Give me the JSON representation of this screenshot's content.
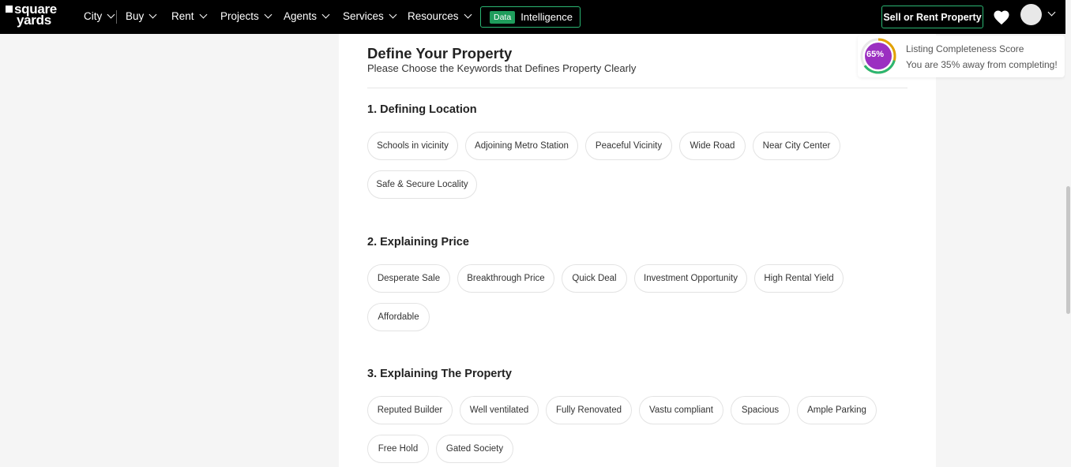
{
  "header": {
    "logo_line1": "square",
    "logo_line2": "yards",
    "nav": [
      {
        "label": "City"
      },
      {
        "label": "Buy"
      },
      {
        "label": "Rent"
      },
      {
        "label": "Projects"
      },
      {
        "label": "Agents"
      },
      {
        "label": "Services"
      },
      {
        "label": "Resources"
      }
    ],
    "data_badge": "Data",
    "data_label": "Intelligence",
    "sell_label": "Sell or Rent Property"
  },
  "form": {
    "title": "Define Your Property",
    "subtitle": "Please Choose the Keywords that Defines Property Clearly",
    "sections": [
      {
        "title": "1. Defining Location",
        "chips": [
          "Schools in vicinity",
          "Adjoining Metro Station",
          "Peaceful Vicinity",
          "Wide Road",
          "Near City Center",
          "Safe & Secure Locality"
        ]
      },
      {
        "title": "2. Explaining Price",
        "chips": [
          "Desperate Sale",
          "Breakthrough Price",
          "Quick Deal",
          "Investment Opportunity",
          "High Rental Yield",
          "Affordable"
        ]
      },
      {
        "title": "3. Explaining The Property",
        "chips": [
          "Reputed Builder",
          "Well ventilated",
          "Fully Renovated",
          "Vastu compliant",
          "Spacious",
          "Ample Parking",
          "Free Hold",
          "Gated Society"
        ]
      }
    ]
  },
  "score": {
    "percent_text": "65%",
    "progress": 0.65,
    "title": "Listing Completeness Score",
    "subtitle": "You are 35% away from completing!"
  },
  "colors": {
    "accent_green": "#2bb673",
    "score_purple": "#9b2fc1",
    "score_ring": "#e2a100"
  }
}
